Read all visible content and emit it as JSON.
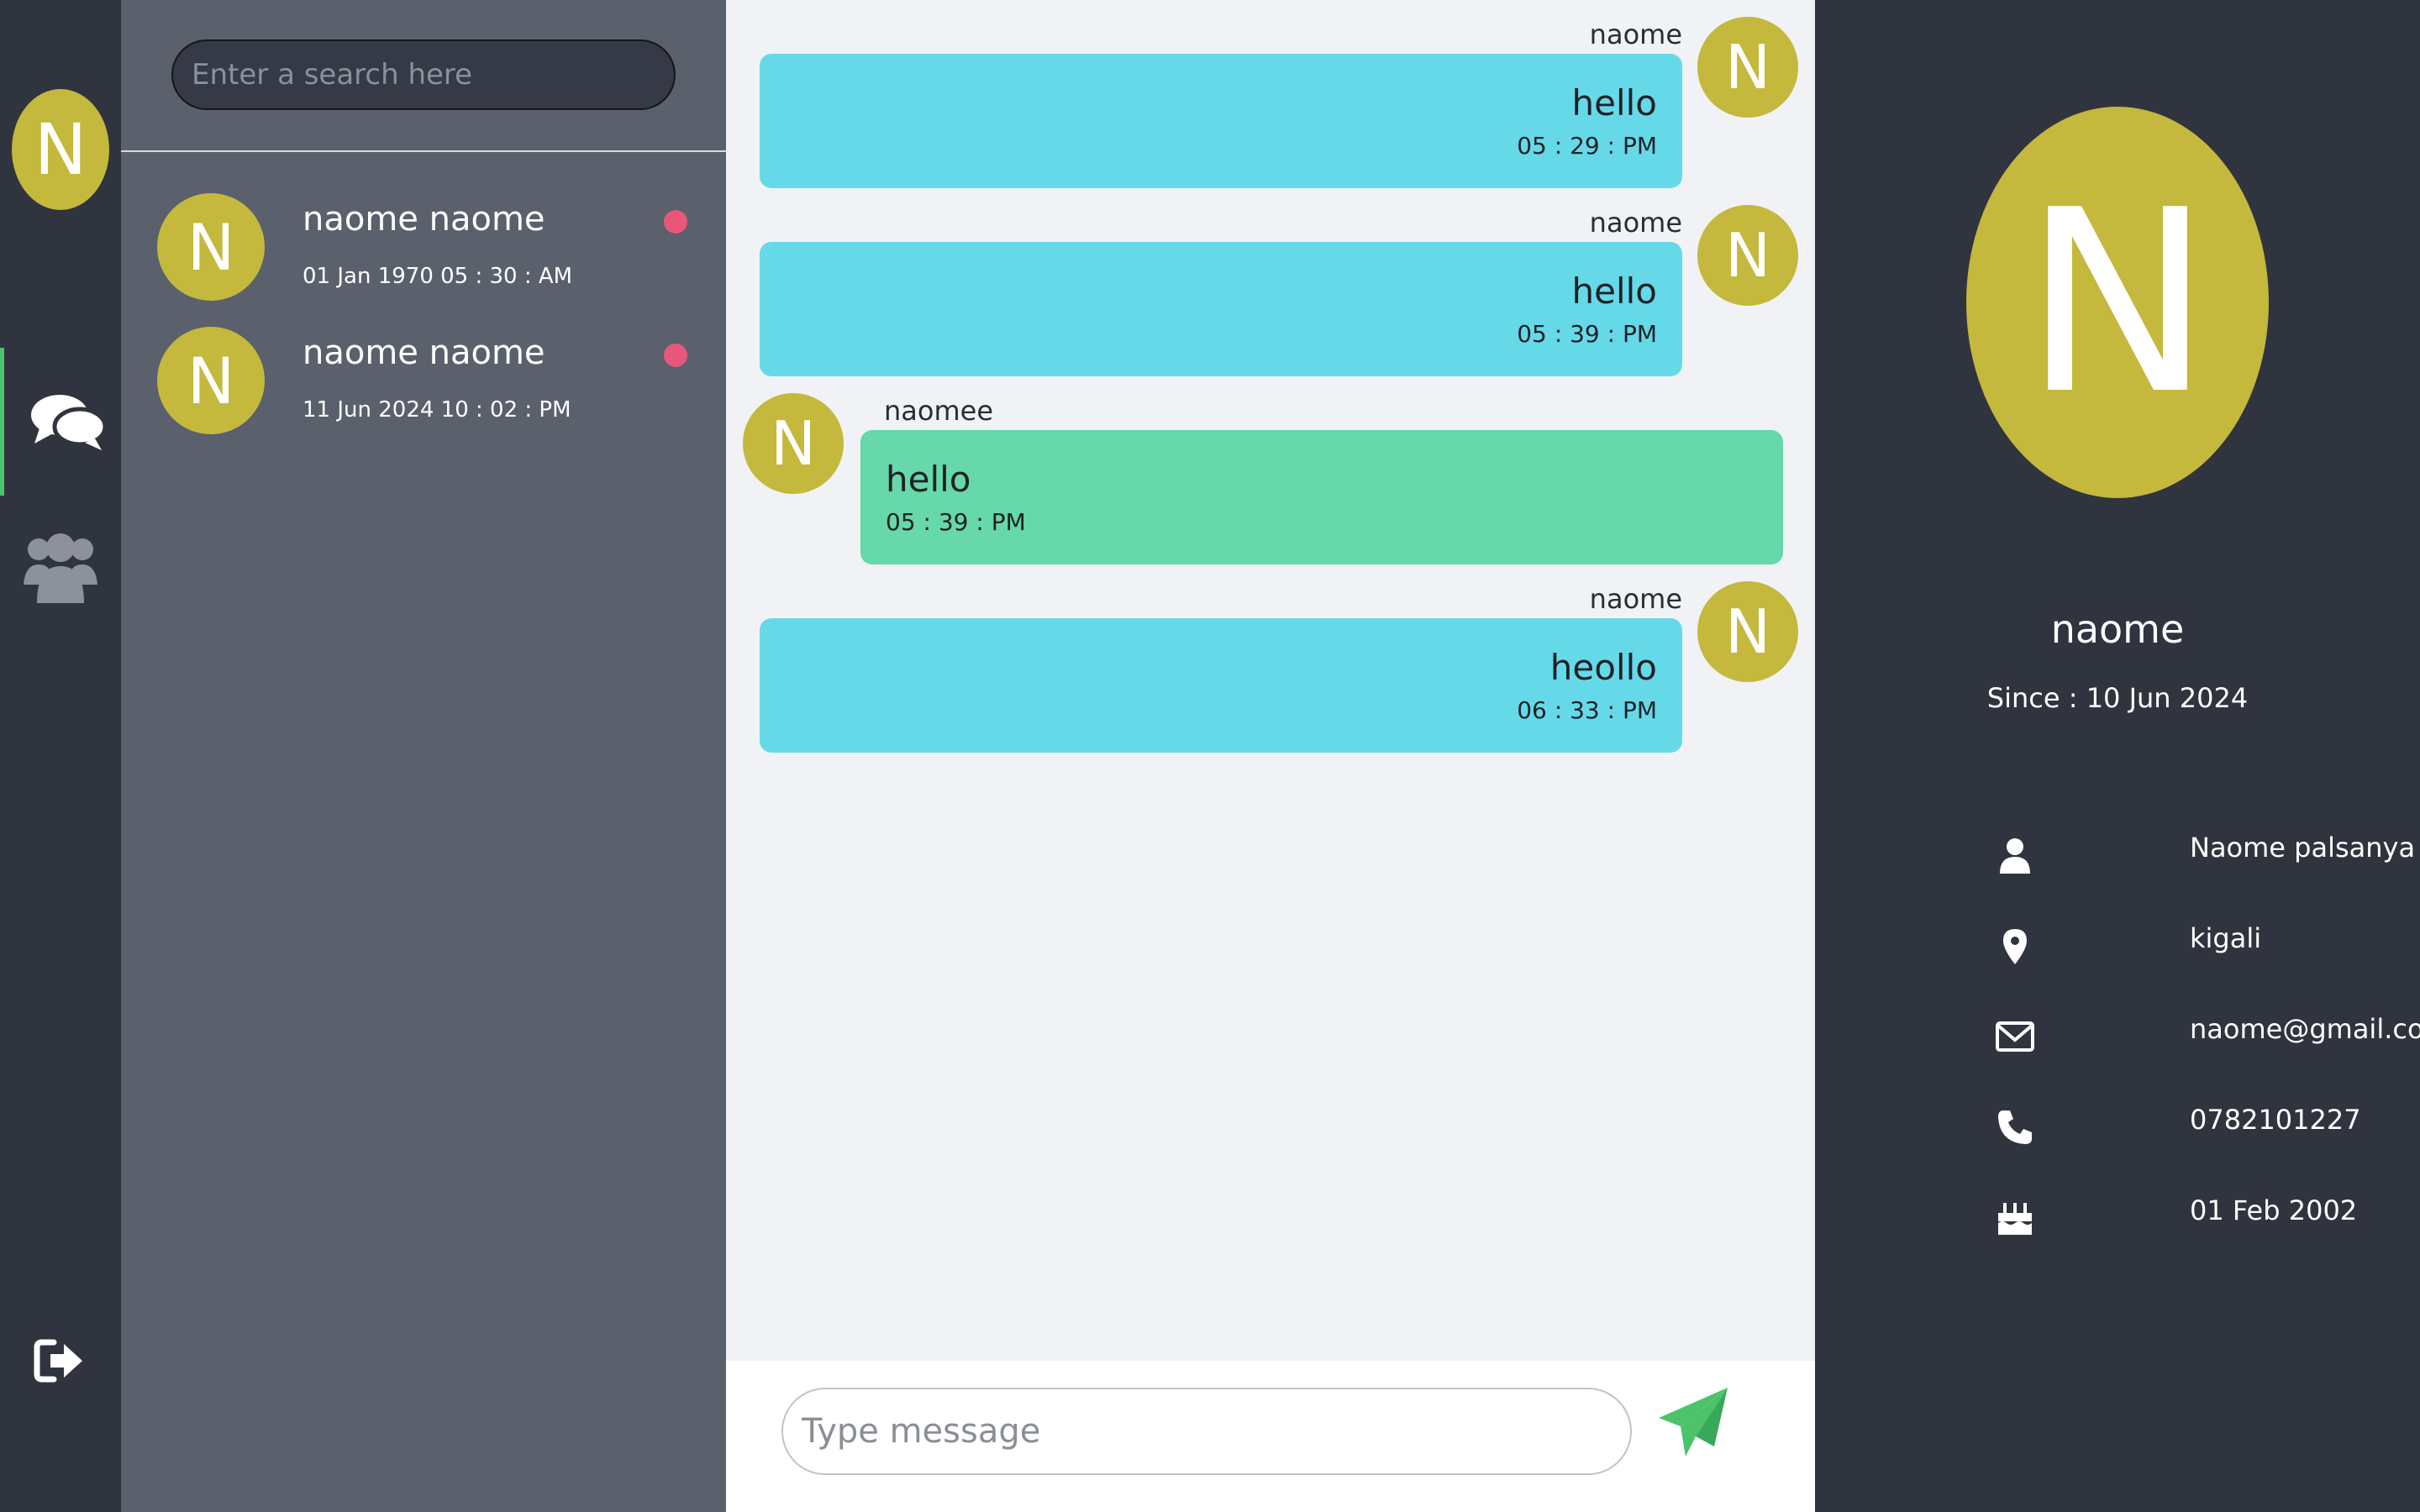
{
  "colors": {
    "rail_bg": "#30343e",
    "list_bg": "#5a606c",
    "chat_bg": "#f0f2f5",
    "avatar": "#c4b83d",
    "outgoing_bubble": "#66d9e8",
    "incoming_bubble": "#66d8a9",
    "unread_dot": "#e8577a",
    "accent_green": "#4cc36b"
  },
  "rail": {
    "avatar_initial": "N",
    "icons": [
      "chat-bubbles-icon",
      "users-group-icon",
      "logout-icon"
    ]
  },
  "search": {
    "placeholder": "Enter a search here"
  },
  "conversations": [
    {
      "initial": "N",
      "name": "naome naome",
      "time": "01 Jan 1970 05 : 30 : AM",
      "unread": true
    },
    {
      "initial": "N",
      "name": "naome naome",
      "time": "11 Jun 2024 10 : 02 : PM",
      "unread": true
    }
  ],
  "messages": [
    {
      "sender": "naome",
      "initial": "N",
      "text": "hello",
      "time": "05 : 29 : PM",
      "direction": "out"
    },
    {
      "sender": "naome",
      "initial": "N",
      "text": "hello",
      "time": "05 : 39 : PM",
      "direction": "out"
    },
    {
      "sender": "naomee",
      "initial": "N",
      "text": "hello",
      "time": "05 : 39 : PM",
      "direction": "in"
    },
    {
      "sender": "naome",
      "initial": "N",
      "text": "heollo",
      "time": "06 : 33 : PM",
      "direction": "out"
    }
  ],
  "composer": {
    "placeholder": "Type message",
    "send_icon": "paper-plane-icon"
  },
  "profile": {
    "initial": "N",
    "name": "naome",
    "since": "Since : 10 Jun 2024",
    "fullname": "Naome palsanya",
    "location": "kigali",
    "email": "naome@gmail.com",
    "phone": "0782101227",
    "birthday": "01 Feb 2002",
    "icons": [
      "user-icon",
      "map-pin-icon",
      "envelope-icon",
      "phone-icon",
      "birthday-cake-icon"
    ]
  }
}
